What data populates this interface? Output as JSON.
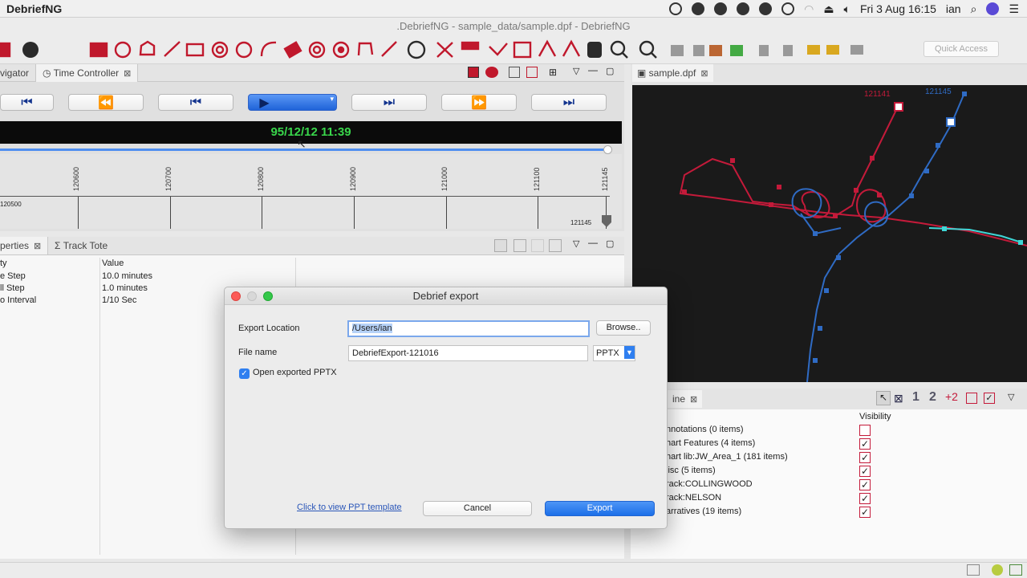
{
  "menubar": {
    "app_name": "DebriefNG",
    "clock": "Fri 3 Aug  16:15",
    "user": "ian"
  },
  "window": {
    "title": ".DebriefNG - sample_data/sample.dpf - DebriefNG"
  },
  "toolbar": {
    "quick_access_placeholder": "Quick Access"
  },
  "time_controller": {
    "tab_navigator": "vigator",
    "tab_label": "Time Controller",
    "current_time": "95/12/12 11:39",
    "ticks": [
      "120600",
      "120700",
      "120800",
      "120900",
      "121000",
      "121100",
      "121145"
    ],
    "start_label": "120500",
    "end_label": "121145",
    "slider_fraction": 0.98
  },
  "properties": {
    "tab_label": "perties",
    "tab_track_tote": "Track Tote",
    "col_property": "ty",
    "col_value": "Value",
    "rows": [
      {
        "name": "e Step",
        "value": "10.0 minutes"
      },
      {
        "name": "ll Step",
        "value": "1.0 minutes"
      },
      {
        "name": "o Interval",
        "value": "1/10 Sec"
      }
    ]
  },
  "map": {
    "tab_label": "sample.dpf",
    "track_red_label": "121141",
    "track_blue_label": "121145",
    "colors": {
      "red": "#c41a3a",
      "blue": "#2f6bc4",
      "cyan": "#3fd6d6"
    }
  },
  "outline": {
    "tab_label": "ine",
    "col_visibility": "Visibility",
    "items": [
      {
        "label": "nnotations (0 items)",
        "visible": false
      },
      {
        "label": "hart Features (4 items)",
        "visible": true
      },
      {
        "label": "hart lib:JW_Area_1 (181 items)",
        "visible": true
      },
      {
        "label": "lisc (5 items)",
        "visible": true
      },
      {
        "label": "rack:COLLINGWOOD",
        "visible": true
      },
      {
        "label": "rack:NELSON",
        "visible": true
      },
      {
        "label": "arratives (19 items)",
        "visible": true
      }
    ]
  },
  "dialog": {
    "title": "Debrief export",
    "export_location_label": "Export Location",
    "export_location_value": "/Users/ian",
    "browse_label": "Browse..",
    "file_name_label": "File name",
    "file_name_value": "DebriefExport-121016",
    "format_value": "PPTX",
    "open_checkbox_label": "Open exported PPTX",
    "open_checked": true,
    "template_link": "Click to view PPT template",
    "cancel_label": "Cancel",
    "export_label": "Export"
  }
}
